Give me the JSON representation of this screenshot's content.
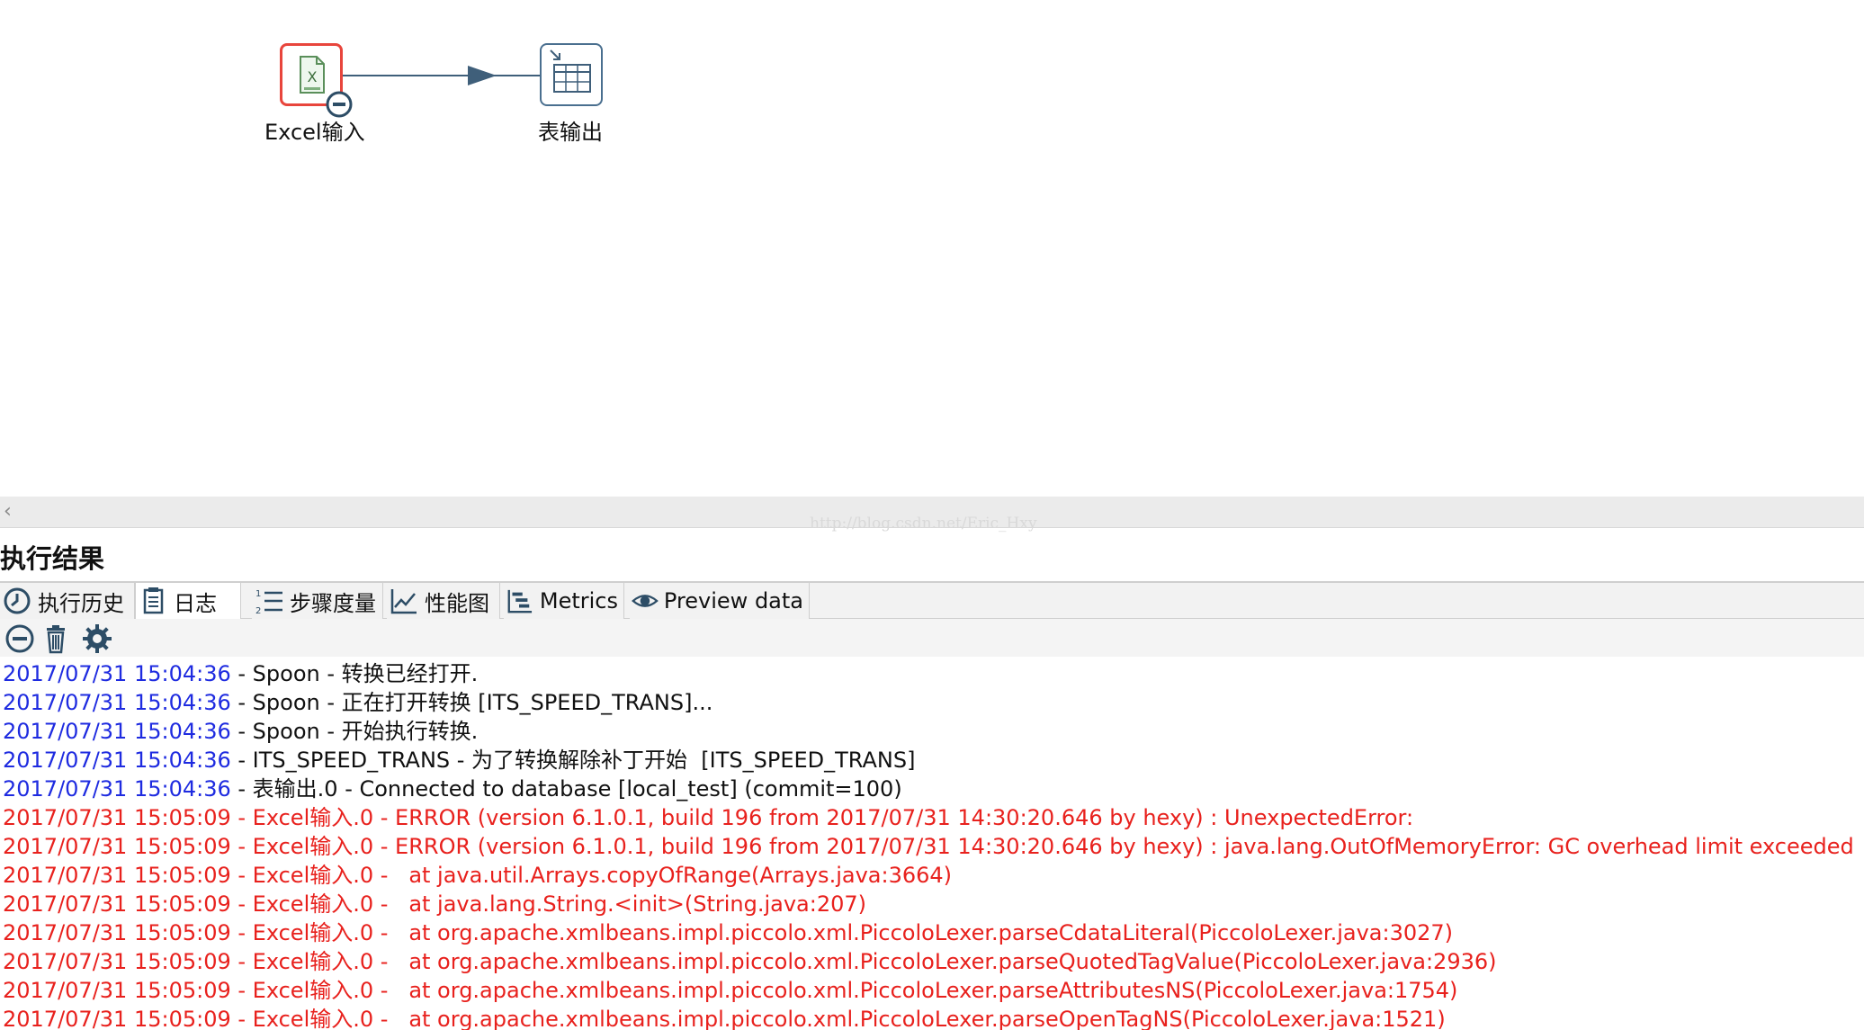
{
  "canvas": {
    "steps": [
      {
        "label": "Excel输入",
        "icon": "excel-file-icon",
        "status": "error"
      },
      {
        "label": "表输出",
        "icon": "table-output-icon",
        "status": "normal"
      }
    ]
  },
  "watermark": "http://blog.csdn.net/Eric_Hxy",
  "results": {
    "title": "执行结果",
    "tabs": [
      {
        "label": "执行历史",
        "icon": "history-clock-icon"
      },
      {
        "label": "日志",
        "icon": "log-document-icon",
        "active": true
      },
      {
        "label": "步骤度量",
        "icon": "step-metrics-list-icon"
      },
      {
        "label": "性能图",
        "icon": "performance-chart-icon"
      },
      {
        "label": "Metrics",
        "icon": "metrics-gantt-icon"
      },
      {
        "label": "Preview data",
        "icon": "preview-eye-icon"
      }
    ],
    "toolbar": [
      "stop-icon",
      "trash-icon",
      "settings-gear-icon"
    ],
    "log_lines": [
      {
        "ts": "2017/07/31 15:04:36",
        "msg": " - Spoon - 转换已经打开.",
        "level": "info"
      },
      {
        "ts": "2017/07/31 15:04:36",
        "msg": " - Spoon - 正在打开转换 [ITS_SPEED_TRANS]...",
        "level": "info"
      },
      {
        "ts": "2017/07/31 15:04:36",
        "msg": " - Spoon - 开始执行转换.",
        "level": "info"
      },
      {
        "ts": "2017/07/31 15:04:36",
        "msg": " - ITS_SPEED_TRANS - 为了转换解除补丁开始  [ITS_SPEED_TRANS]",
        "level": "info"
      },
      {
        "ts": "2017/07/31 15:04:36",
        "msg": " - 表输出.0 - Connected to database [local_test] (commit=100)",
        "level": "info"
      },
      {
        "ts": "2017/07/31 15:05:09",
        "msg": " - Excel输入.0 - ERROR (version 6.1.0.1, build 196 from 2017/07/31 14:30:20.646 by hexy) : UnexpectedError:",
        "level": "error"
      },
      {
        "ts": "2017/07/31 15:05:09",
        "msg": " - Excel输入.0 - ERROR (version 6.1.0.1, build 196 from 2017/07/31 14:30:20.646 by hexy) : java.lang.OutOfMemoryError: GC overhead limit exceeded",
        "level": "error"
      },
      {
        "ts": "2017/07/31 15:05:09",
        "msg": " - Excel输入.0 -   at java.util.Arrays.copyOfRange(Arrays.java:3664)",
        "level": "error"
      },
      {
        "ts": "2017/07/31 15:05:09",
        "msg": " - Excel输入.0 -   at java.lang.String.<init>(String.java:207)",
        "level": "error"
      },
      {
        "ts": "2017/07/31 15:05:09",
        "msg": " - Excel输入.0 -   at org.apache.xmlbeans.impl.piccolo.xml.PiccoloLexer.parseCdataLiteral(PiccoloLexer.java:3027)",
        "level": "error"
      },
      {
        "ts": "2017/07/31 15:05:09",
        "msg": " - Excel输入.0 -   at org.apache.xmlbeans.impl.piccolo.xml.PiccoloLexer.parseQuotedTagValue(PiccoloLexer.java:2936)",
        "level": "error"
      },
      {
        "ts": "2017/07/31 15:05:09",
        "msg": " - Excel输入.0 -   at org.apache.xmlbeans.impl.piccolo.xml.PiccoloLexer.parseAttributesNS(PiccoloLexer.java:1754)",
        "level": "error"
      },
      {
        "ts": "2017/07/31 15:05:09",
        "msg": " - Excel输入.0 -   at org.apache.xmlbeans.impl.piccolo.xml.PiccoloLexer.parseOpenTagNS(PiccoloLexer.java:1521)",
        "level": "error"
      }
    ]
  }
}
